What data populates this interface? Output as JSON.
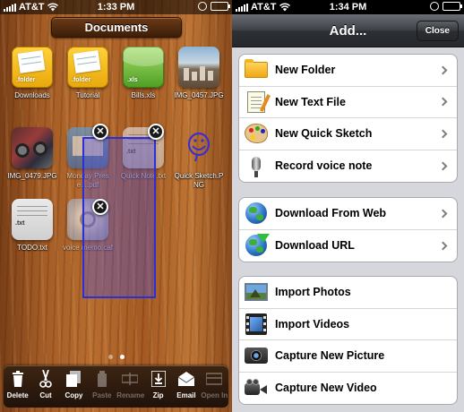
{
  "left": {
    "status": {
      "carrier": "AT&T",
      "time": "1:33 PM",
      "battery_level": 0.85
    },
    "title": "Documents",
    "tiles": [
      {
        "label": "Downloads",
        "kind": "folder",
        "ext": ".folder"
      },
      {
        "label": "Tutorial",
        "kind": "folder",
        "ext": ".folder"
      },
      {
        "label": "Bills.xls",
        "kind": "xls",
        "ext": ".xls"
      },
      {
        "label": "IMG_0457.JPG",
        "kind": "photo"
      },
      {
        "label": "IMG_0479.JPG",
        "kind": "photo"
      },
      {
        "label": "Monday Prese....pdf",
        "kind": "pdf"
      },
      {
        "label": "Quick Note.txt",
        "kind": "txt",
        "ext": ".txt"
      },
      {
        "label": "Quick Sketch.PNG",
        "kind": "sketch"
      },
      {
        "label": "TODO.txt",
        "kind": "txt",
        "ext": ".txt"
      },
      {
        "label": "voice memo.caf",
        "kind": "caf"
      }
    ],
    "delete_badge": "✕",
    "toolbar": {
      "delete": "Delete",
      "cut": "Cut",
      "copy": "Copy",
      "paste": "Paste",
      "rename": "Rename",
      "zip": "Zip",
      "email": "Email",
      "open_in": "Open In"
    },
    "colors": {
      "selection": "#2a2fd8",
      "sketch": "#3a2fd0"
    }
  },
  "right": {
    "status": {
      "carrier": "AT&T",
      "time": "1:34 PM",
      "battery_level": 0.85
    },
    "title": "Add...",
    "close_label": "Close",
    "groups": [
      [
        {
          "label": "New Folder",
          "icon": "folder-icon"
        },
        {
          "label": "New Text File",
          "icon": "text-file-icon"
        },
        {
          "label": "New Quick Sketch",
          "icon": "palette-icon"
        },
        {
          "label": "Record voice note",
          "icon": "microphone-icon"
        }
      ],
      [
        {
          "label": "Download From Web",
          "icon": "globe-icon"
        },
        {
          "label": "Download URL",
          "icon": "globe-download-icon"
        }
      ],
      [
        {
          "label": "Import Photos",
          "icon": "photo-icon"
        },
        {
          "label": "Import Videos",
          "icon": "film-icon"
        },
        {
          "label": "Capture New Picture",
          "icon": "camera-icon"
        },
        {
          "label": "Capture New Video",
          "icon": "video-camera-icon"
        }
      ]
    ]
  }
}
